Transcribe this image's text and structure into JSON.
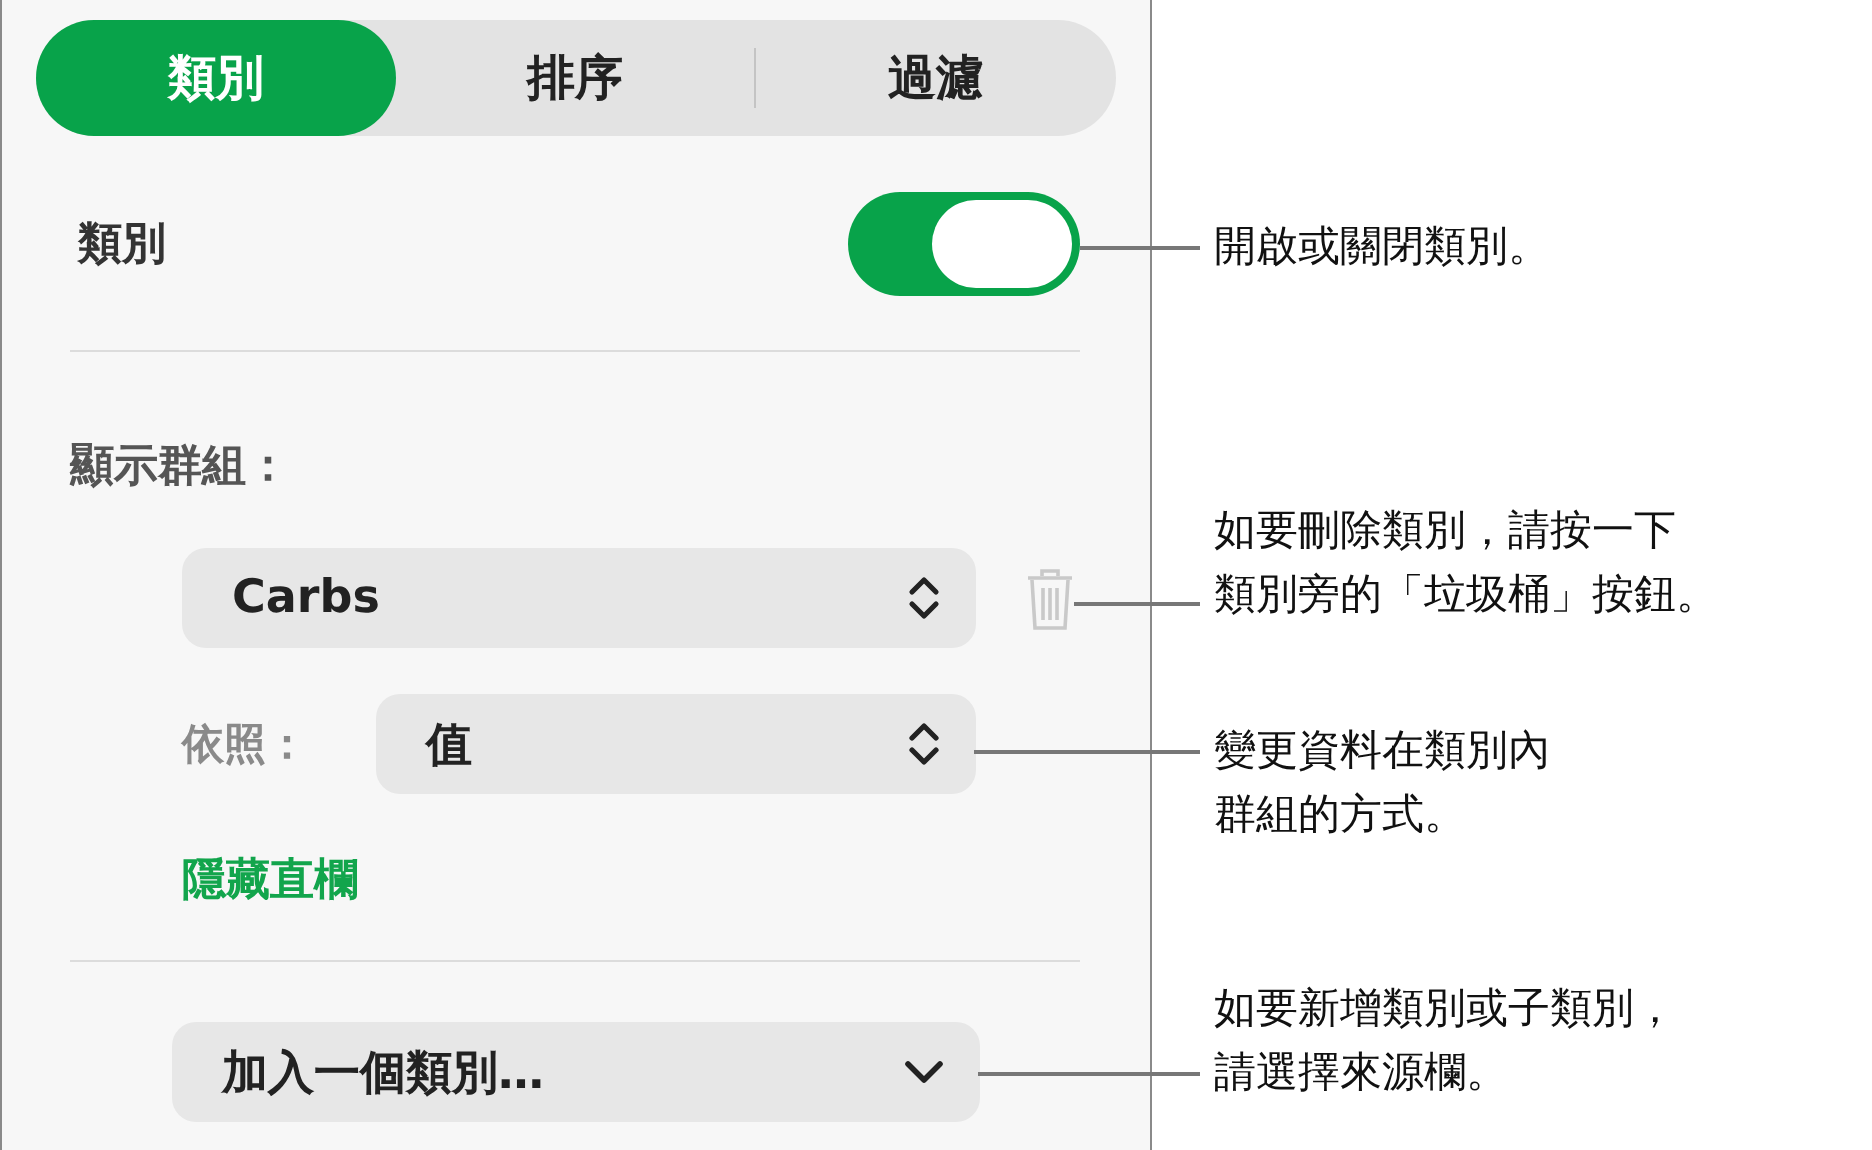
{
  "tabs": [
    {
      "label": "類別",
      "selected": true
    },
    {
      "label": "排序",
      "selected": false
    },
    {
      "label": "過濾",
      "selected": false
    }
  ],
  "category_toggle": {
    "label": "類別",
    "on": true
  },
  "group_heading": "顯示群組：",
  "group_field": {
    "value": "Carbs"
  },
  "group_by": {
    "label": "依照：",
    "value": "值"
  },
  "hide_columns_link": "隱藏直欄",
  "add_category": {
    "value": "加入一個類別…"
  },
  "callouts": [
    {
      "lines": [
        "開啟或關閉類別。"
      ]
    },
    {
      "lines": [
        "如要刪除類別，請按一下",
        "類別旁的「垃圾桶」按鈕。"
      ]
    },
    {
      "lines": [
        "變更資料在類別內",
        "群組的方式。"
      ]
    },
    {
      "lines": [
        "如要新增類別或子類別，",
        "請選擇來源欄。"
      ]
    }
  ]
}
